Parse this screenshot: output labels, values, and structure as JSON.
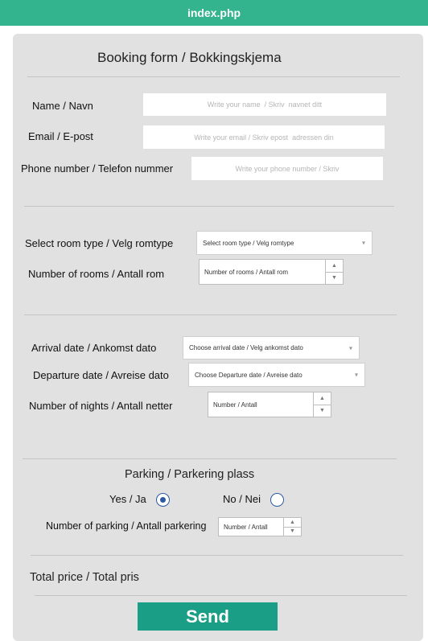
{
  "window": {
    "title": "index.php"
  },
  "form": {
    "title": "Booking form /  Bokkingskjema",
    "name": {
      "label": "Name / Navn",
      "placeholder": "Write your name  / Skriv  navnet ditt"
    },
    "email": {
      "label": "Email / E-post",
      "placeholder": "Write your email / Skriv epost  adressen din"
    },
    "phone": {
      "label": "Phone number  / Telefon nummer",
      "placeholder": "Write your phone number / Skriv"
    },
    "room_type": {
      "label": "Select room type / Velg romtype",
      "value": "Select room type / Velg romtype",
      "arrow_icon": "chevron-down-icon"
    },
    "room_count": {
      "label": "Number of  rooms / Antall rom",
      "value": "Number of rooms / Antall rom"
    },
    "arrival": {
      "label": "Arrival date / Ankomst dato",
      "value": "Choose arrival date  / Velg ankomst dato"
    },
    "departure": {
      "label": "Departure date / Avreise dato",
      "value": "Choose  Departure date /  Avreise dato"
    },
    "nights": {
      "label": "Number of nights / Antall netter",
      "value": "Number / Antall"
    },
    "parking": {
      "title": "Parking / Parkering plass",
      "yes_label": "Yes / Ja",
      "no_label": "No /  Nei",
      "selected": "yes",
      "count_label": "Number of parking  / Antall parkering",
      "count_value": "Number / Antall"
    },
    "total_label": "Total  price / Total pris",
    "send_label": "Send"
  },
  "colors": {
    "topbar": "#33b38e",
    "send_button": "#1a9e85",
    "card": "#e1e1e1",
    "radio": "#2c5aa0"
  }
}
